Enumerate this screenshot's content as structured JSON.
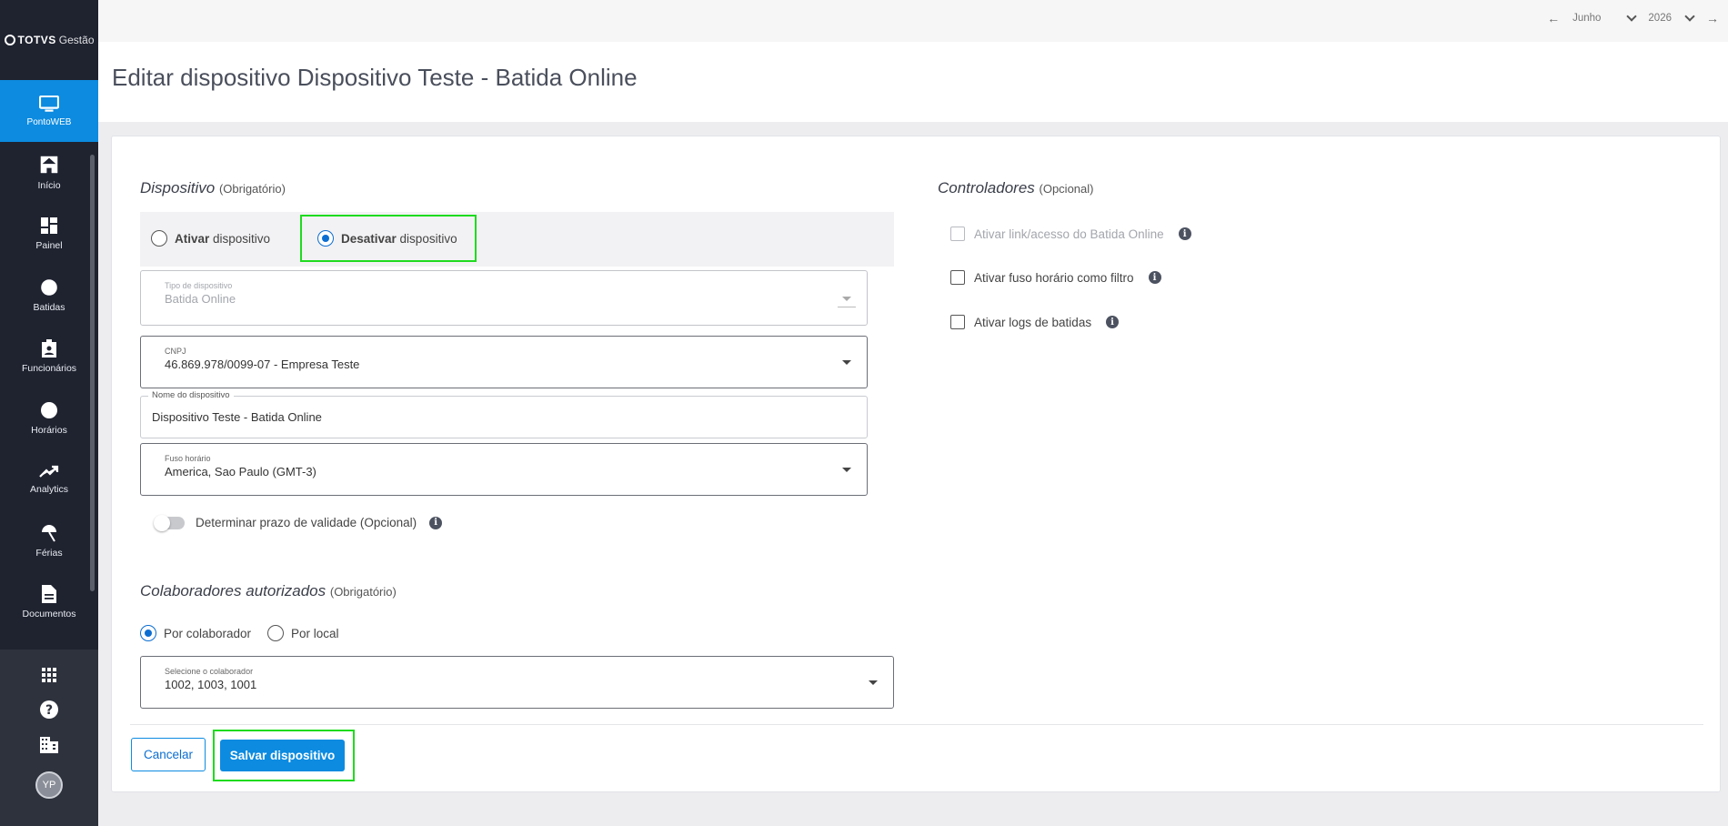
{
  "sidebar": {
    "logo_brand": "TOTVS",
    "logo_product": "Gestão",
    "module_label": "PontoWEB",
    "items": [
      {
        "label": "Início",
        "icon": "home-icon"
      },
      {
        "label": "Painel",
        "icon": "dashboard-icon"
      },
      {
        "label": "Batidas",
        "icon": "fingerprint-icon"
      },
      {
        "label": "Funcionários",
        "icon": "badge-icon"
      },
      {
        "label": "Horários",
        "icon": "clock-icon"
      },
      {
        "label": "Analytics",
        "icon": "trending-icon"
      },
      {
        "label": "Férias",
        "icon": "umbrella-icon"
      },
      {
        "label": "Documentos",
        "icon": "document-icon"
      }
    ],
    "bottom_icons": [
      "apps-grid-icon",
      "help-icon",
      "building-icon"
    ],
    "avatar_initials": "YP"
  },
  "topbar": {
    "month": "Junho",
    "year": "2026"
  },
  "page": {
    "title": "Editar dispositivo Dispositivo Teste - Batida Online"
  },
  "device": {
    "section_title": "Dispositivo",
    "section_note": "(Obrigatório)",
    "activate_bold": "Ativar",
    "activate_rest": " dispositivo",
    "deactivate_bold": "Desativar",
    "deactivate_rest": " dispositivo",
    "type_label": "Tipo de dispositivo",
    "type_value": "Batida Online",
    "cnpj_label": "CNPJ",
    "cnpj_value": "46.869.978/0099-07 - Empresa Teste",
    "name_label": "Nome do dispositivo",
    "name_value": "Dispositivo Teste - Batida Online",
    "tz_label": "Fuso horário",
    "tz_value": "America, Sao Paulo (GMT-3)",
    "validity_label": "Determinar prazo de validade (Opcional)"
  },
  "controllers": {
    "section_title": "Controladores",
    "section_note": "(Opcional)",
    "options": [
      {
        "label": "Ativar link/acesso do Batida Online",
        "disabled": true
      },
      {
        "label": "Ativar fuso horário como filtro",
        "disabled": false
      },
      {
        "label": "Ativar logs de batidas",
        "disabled": false
      }
    ]
  },
  "collaborators": {
    "section_title": "Colaboradores autorizados",
    "section_note": "(Obrigatório)",
    "by_collaborator": "Por colaborador",
    "by_location": "Por local",
    "select_label": "Selecione o colaborador",
    "select_value": "1002, 1003, 1001"
  },
  "actions": {
    "cancel": "Cancelar",
    "save": "Salvar dispositivo"
  },
  "colors": {
    "primary": "#0c8be0",
    "sidebar_bg": "#1f2330",
    "highlight": "#1fdb1f"
  }
}
